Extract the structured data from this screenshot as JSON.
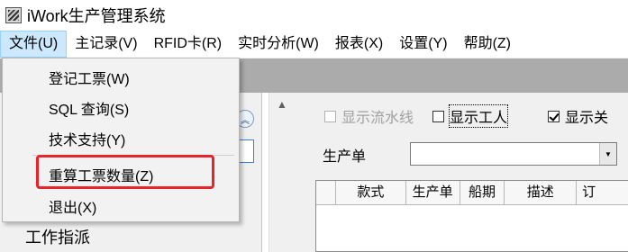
{
  "app": {
    "title": "iWork生产管理系统",
    "icon": "app-icon"
  },
  "menubar": {
    "items": [
      {
        "label": "文件(U)",
        "active": true
      },
      {
        "label": "主记录(V)"
      },
      {
        "label": "RFID卡(R)"
      },
      {
        "label": "实时分析(W)"
      },
      {
        "label": "报表(X)"
      },
      {
        "label": "设置(Y)"
      },
      {
        "label": "帮助(Z)"
      }
    ]
  },
  "file_menu": {
    "items": [
      {
        "label": "登记工票(W)"
      },
      {
        "label": "SQL 查询(S)"
      },
      {
        "label": "技术支持(Y)"
      },
      {
        "label": "重算工票数量(Z)",
        "highlighted": true
      },
      {
        "label": "退出(X)"
      }
    ]
  },
  "left_panel": {
    "work_assign": "工作指派"
  },
  "options": {
    "show_flow": {
      "label": "显示流水线",
      "checked": false,
      "enabled": false
    },
    "show_worker": {
      "label": "显示工人",
      "checked": false,
      "enabled": true
    },
    "show_related": {
      "label": "显示关",
      "checked": true,
      "enabled": true
    }
  },
  "order_filter": {
    "label": "生产单",
    "value": ""
  },
  "grid": {
    "columns": [
      "款式",
      "生产单",
      "船期",
      "描述",
      "订"
    ]
  },
  "colors": {
    "highlight": "#e8242a",
    "menu_active": "#cce8ff"
  }
}
